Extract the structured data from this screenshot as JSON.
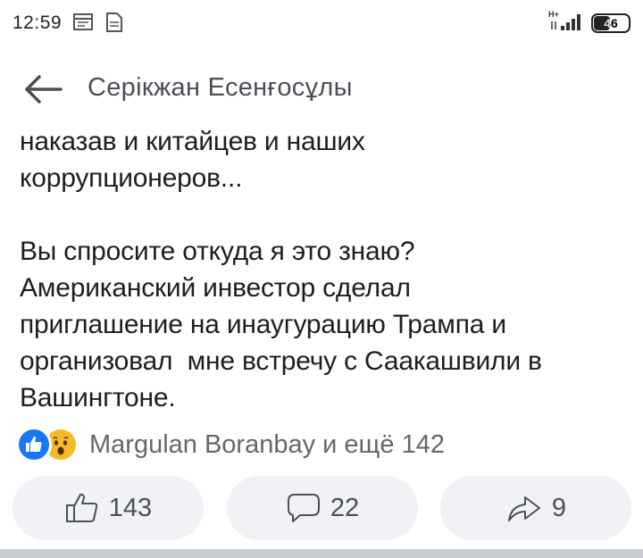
{
  "status_bar": {
    "time": "12:59",
    "network": "H+",
    "battery": "46"
  },
  "header": {
    "title": "Серікжан Есенғосұлы"
  },
  "post": {
    "lines": [
      "наказав и китайцев и наших",
      "коррупционеров...",
      "",
      "Вы спросите откуда я это знаю?",
      "Американский инвестор сделал",
      "приглашение на инаугурацию Трампа и",
      "организовал  мне встречу с Саакашвили в",
      "Вашингтоне."
    ]
  },
  "reactions": {
    "summary": "Margulan Boranbay и ещё 142",
    "icons": [
      "like-reaction-icon",
      "wow-reaction-icon"
    ]
  },
  "actions": {
    "like_count": "143",
    "comment_count": "22",
    "share_count": "9"
  },
  "colors": {
    "accent": "#1877f2",
    "wow": "#f7b928",
    "button_bg": "#f0f2f5",
    "secondary_text": "#65676b"
  }
}
